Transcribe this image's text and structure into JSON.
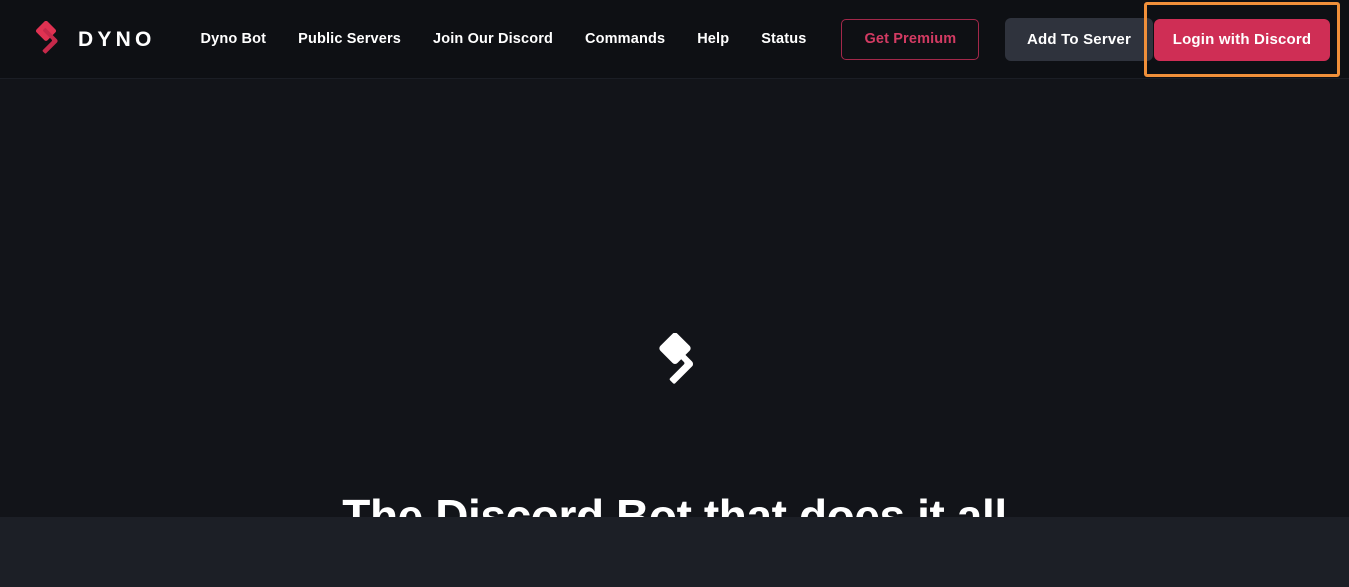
{
  "header": {
    "brand": {
      "logo_icon": "dyno-diamond-logo",
      "wordmark": "DYNO",
      "logo_color": "#e03252"
    },
    "nav_links": [
      {
        "label": "Dyno Bot"
      },
      {
        "label": "Public Servers"
      },
      {
        "label": "Join Our Discord"
      },
      {
        "label": "Commands"
      },
      {
        "label": "Help"
      },
      {
        "label": "Status"
      }
    ],
    "premium_button": {
      "label": "Get Premium",
      "text_color": "#d33b63",
      "border_color": "#a3284a"
    },
    "add_to_server_button": {
      "label": "Add To Server",
      "background_color": "#2f333d"
    },
    "login_button": {
      "label": "Login with Discord",
      "background_color": "#cf2e55",
      "text_color": "#ffffff"
    },
    "highlight": {
      "target": "login-with-discord-button",
      "border_color": "#f0903a"
    },
    "background_color": "#0e1014"
  },
  "hero": {
    "logo_icon": "dyno-diamond-logo-white",
    "title": "The Discord Bot that does it all",
    "background_color": "#121419"
  },
  "bottom_band": {
    "background_color": "#1c1f26"
  }
}
